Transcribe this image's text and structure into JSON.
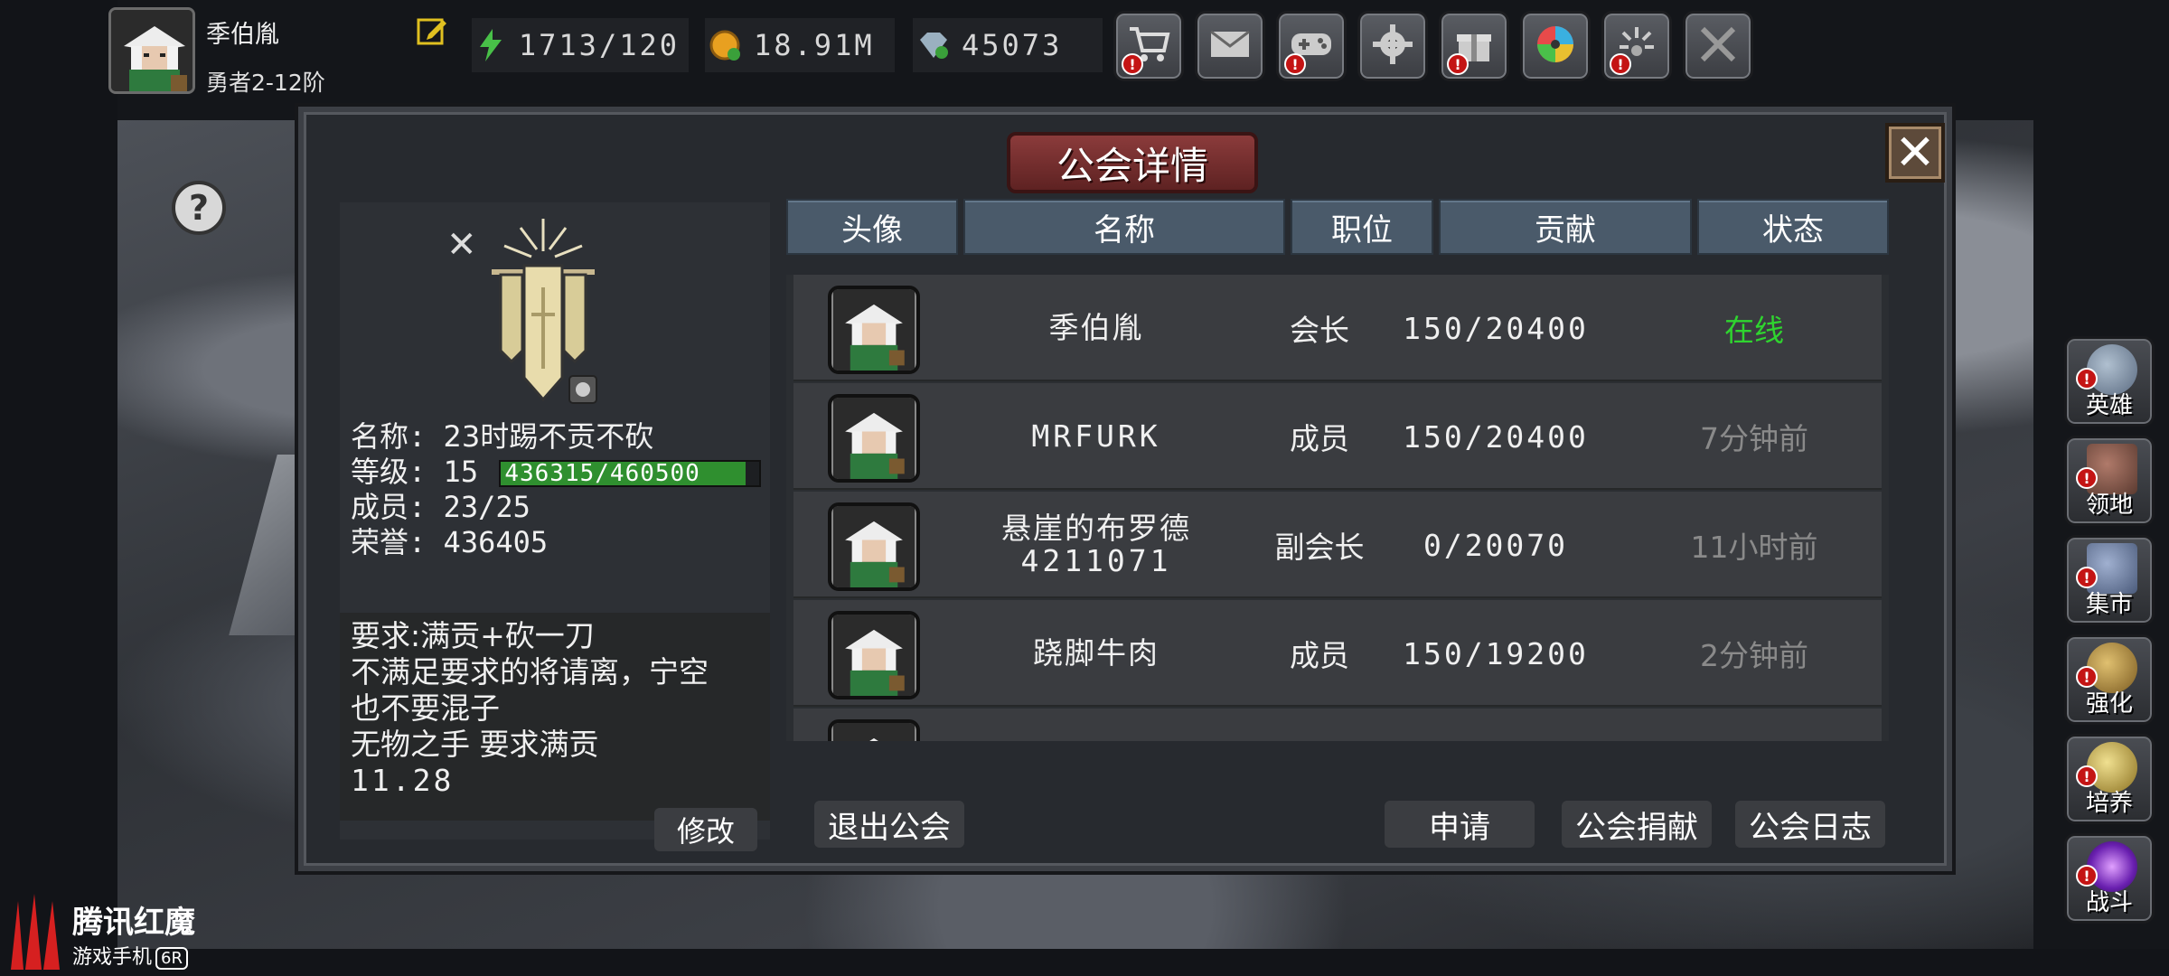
{
  "player": {
    "name": "季伯胤",
    "rank": "勇者2-12阶"
  },
  "resources": {
    "energy": "1713/120",
    "gold": "18.91M",
    "diamonds": "45073"
  },
  "hud_buttons": [
    {
      "name": "shop",
      "icon": "cart-icon",
      "alert": "!"
    },
    {
      "name": "mail",
      "icon": "mail-icon",
      "alert": ""
    },
    {
      "name": "events",
      "icon": "gamepad-icon",
      "alert": "!"
    },
    {
      "name": "settings",
      "icon": "gear-icon",
      "alert": ""
    },
    {
      "name": "gift",
      "icon": "gift-icon",
      "alert": "!"
    },
    {
      "name": "lottery",
      "icon": "wheel-icon",
      "alert": ""
    },
    {
      "name": "fireworks",
      "icon": "firework-icon",
      "alert": "!"
    },
    {
      "name": "battle-off",
      "icon": "crossed-swords-icon",
      "alert": ""
    }
  ],
  "dialog": {
    "title": "公会详情",
    "close": "✕"
  },
  "guild": {
    "name_label": "名称:",
    "name": "23时踢不贡不砍",
    "level_label": "等级:",
    "level": "15",
    "xp_text": "436315/460500",
    "xp_progress": 0.9475,
    "members_label": "成员:",
    "members": "23/25",
    "honor_label": "荣誉:",
    "honor": "436405",
    "description": [
      "要求:满贡+砍一刀",
      "不满足要求的将请离，宁空",
      "也不要混子",
      "无物之手  要求满贡",
      "11.28"
    ],
    "modify_label": "修改"
  },
  "table": {
    "headers": [
      "头像",
      "名称",
      "职位",
      "贡献",
      "状态"
    ],
    "rows": [
      {
        "name": "季伯胤",
        "name2": "",
        "role": "会长",
        "contribution": "150/20400",
        "status": "在线",
        "online": true
      },
      {
        "name": "MRFURK",
        "name2": "",
        "role": "成员",
        "contribution": "150/20400",
        "status": "7分钟前",
        "online": false
      },
      {
        "name": "悬崖的布罗德",
        "name2": "4211071",
        "role": "副会长",
        "contribution": "0/20070",
        "status": "11小时前",
        "online": false
      },
      {
        "name": "跷脚牛肉",
        "name2": "",
        "role": "成员",
        "contribution": "150/19200",
        "status": "2分钟前",
        "online": false
      }
    ]
  },
  "actions": {
    "quit": "退出公会",
    "apply": "申请",
    "donate": "公会捐献",
    "log": "公会日志"
  },
  "side_menu": [
    {
      "label": "英雄",
      "icon": "helmet-icon",
      "color": "#7a8aa0",
      "alert": "!"
    },
    {
      "label": "领地",
      "icon": "castle-icon",
      "color": "#8a5a4a",
      "alert": "!"
    },
    {
      "label": "集市",
      "icon": "market-icon",
      "color": "#6a7a9a",
      "alert": "!"
    },
    {
      "label": "强化",
      "icon": "forge-icon",
      "color": "#b88a3a",
      "alert": "!"
    },
    {
      "label": "培养",
      "icon": "chalice-icon",
      "color": "#c8b04a",
      "alert": "!"
    },
    {
      "label": "战斗",
      "icon": "portal-icon",
      "color": "#8a3ad0",
      "alert": "!"
    }
  ],
  "watermark": {
    "title": "腾讯红魔",
    "subtitle": "游戏手机",
    "badge": "6R"
  },
  "colors": {
    "online": "#2fd52f",
    "offline": "#8a8a8a",
    "xp_fill": "#2f8f2f",
    "header_bg": "#4a5a6a",
    "title_banner": "#8b3b3b"
  }
}
